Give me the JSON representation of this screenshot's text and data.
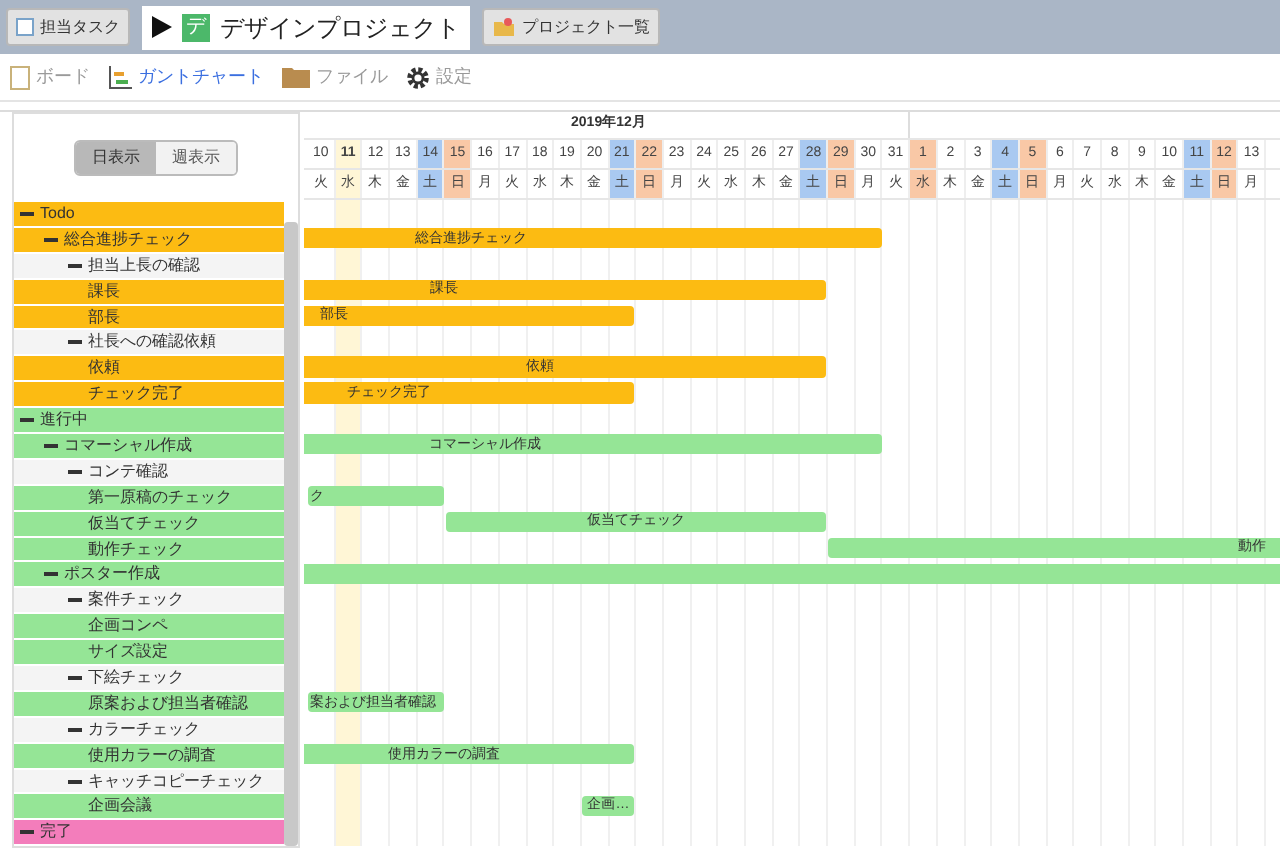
{
  "top_tabs": [
    {
      "label": "担当タスク",
      "kind": "task",
      "selected": false
    },
    {
      "label": "デザインプロジェクト",
      "kind": "project",
      "icon_letter": "デ",
      "selected": true
    },
    {
      "label": "プロジェクト一覧",
      "kind": "list",
      "selected": false
    }
  ],
  "nav": [
    {
      "label": "ボード",
      "kind": "board",
      "selected": false
    },
    {
      "label": "ガントチャート",
      "kind": "gantt",
      "selected": true
    },
    {
      "label": "ファイル",
      "kind": "file",
      "selected": false
    },
    {
      "label": "設定",
      "kind": "settings",
      "selected": false
    }
  ],
  "view_toggle": [
    {
      "label": "日表示",
      "selected": true
    },
    {
      "label": "週表示",
      "selected": false
    }
  ],
  "timeline": {
    "month": "2019年12月",
    "days": [
      {
        "day": "10",
        "weekday": "火",
        "kind": "weekday"
      },
      {
        "day": "11",
        "weekday": "水",
        "kind": "today"
      },
      {
        "day": "12",
        "weekday": "木",
        "kind": "weekday"
      },
      {
        "day": "13",
        "weekday": "金",
        "kind": "weekday"
      },
      {
        "day": "14",
        "weekday": "土",
        "kind": "saturday"
      },
      {
        "day": "15",
        "weekday": "日",
        "kind": "holiday"
      },
      {
        "day": "16",
        "weekday": "月",
        "kind": "weekday"
      },
      {
        "day": "17",
        "weekday": "火",
        "kind": "weekday"
      },
      {
        "day": "18",
        "weekday": "水",
        "kind": "weekday"
      },
      {
        "day": "19",
        "weekday": "木",
        "kind": "weekday"
      },
      {
        "day": "20",
        "weekday": "金",
        "kind": "weekday"
      },
      {
        "day": "21",
        "weekday": "土",
        "kind": "saturday"
      },
      {
        "day": "22",
        "weekday": "日",
        "kind": "holiday"
      },
      {
        "day": "23",
        "weekday": "月",
        "kind": "weekday"
      },
      {
        "day": "24",
        "weekday": "火",
        "kind": "weekday"
      },
      {
        "day": "25",
        "weekday": "水",
        "kind": "weekday"
      },
      {
        "day": "26",
        "weekday": "木",
        "kind": "weekday"
      },
      {
        "day": "27",
        "weekday": "金",
        "kind": "weekday"
      },
      {
        "day": "28",
        "weekday": "土",
        "kind": "saturday"
      },
      {
        "day": "29",
        "weekday": "日",
        "kind": "holiday"
      },
      {
        "day": "30",
        "weekday": "月",
        "kind": "weekday"
      },
      {
        "day": "31",
        "weekday": "火",
        "kind": "weekday"
      },
      {
        "day": "1",
        "weekday": "水",
        "kind": "holiday"
      },
      {
        "day": "2",
        "weekday": "木",
        "kind": "weekday"
      },
      {
        "day": "3",
        "weekday": "金",
        "kind": "weekday"
      },
      {
        "day": "4",
        "weekday": "土",
        "kind": "saturday"
      },
      {
        "day": "5",
        "weekday": "日",
        "kind": "holiday"
      },
      {
        "day": "6",
        "weekday": "月",
        "kind": "weekday"
      },
      {
        "day": "7",
        "weekday": "火",
        "kind": "weekday"
      },
      {
        "day": "8",
        "weekday": "水",
        "kind": "weekday"
      },
      {
        "day": "9",
        "weekday": "木",
        "kind": "weekday"
      },
      {
        "day": "10",
        "weekday": "金",
        "kind": "weekday"
      },
      {
        "day": "11",
        "weekday": "土",
        "kind": "saturday"
      },
      {
        "day": "12",
        "weekday": "日",
        "kind": "holiday"
      },
      {
        "day": "13",
        "weekday": "月",
        "kind": "weekday"
      }
    ]
  },
  "tree": [
    {
      "label": "Todo",
      "color": "#fcbb12",
      "expanded": true,
      "children": [
        {
          "label": "総合進捗チェック",
          "kind": "task",
          "expanded": true,
          "bar": "総合進捗チェック",
          "children": [
            {
              "label": "担当上長の確認",
              "kind": "folder",
              "expanded": true,
              "children": [
                {
                  "label": "課長",
                  "kind": "task",
                  "bar": "課長"
                },
                {
                  "label": "部長",
                  "kind": "task",
                  "bar": "部長"
                }
              ]
            },
            {
              "label": "社長への確認依頼",
              "kind": "folder",
              "expanded": true,
              "children": [
                {
                  "label": "依頼",
                  "kind": "task",
                  "bar": "依頼"
                },
                {
                  "label": "チェック完了",
                  "kind": "task",
                  "bar": "チェック完了"
                }
              ]
            }
          ]
        }
      ]
    },
    {
      "label": "進行中",
      "color": "#95e596",
      "expanded": true,
      "children": [
        {
          "label": "コマーシャル作成",
          "kind": "task",
          "expanded": true,
          "bar": "コマーシャル作成",
          "children": [
            {
              "label": "コンテ確認",
              "kind": "folder",
              "expanded": true,
              "children": [
                {
                  "label": "第一原稿のチェック",
                  "kind": "task",
                  "bar": "ク"
                },
                {
                  "label": "仮当てチェック",
                  "kind": "task",
                  "bar": "仮当てチェック"
                },
                {
                  "label": "動作チェック",
                  "kind": "task",
                  "bar": "動作"
                }
              ]
            }
          ]
        },
        {
          "label": "ポスター作成",
          "kind": "task",
          "expanded": true,
          "bar": true,
          "children": [
            {
              "label": "案件チェック",
              "kind": "folder",
              "expanded": true,
              "children": [
                {
                  "label": "企画コンペ",
                  "kind": "task"
                },
                {
                  "label": "サイズ設定",
                  "kind": "task"
                }
              ]
            },
            {
              "label": "下絵チェック",
              "kind": "folder",
              "expanded": true,
              "children": [
                {
                  "label": "原案および担当者確認",
                  "kind": "task",
                  "bar": "案および担当者確認"
                }
              ]
            },
            {
              "label": "カラーチェック",
              "kind": "folder",
              "expanded": true,
              "children": [
                {
                  "label": "使用カラーの調査",
                  "kind": "task",
                  "bar": "使用カラーの調査"
                }
              ]
            },
            {
              "label": "キャッチコピーチェック",
              "kind": "folder",
              "expanded": true,
              "children": [
                {
                  "label": "企画会議",
                  "kind": "task",
                  "bar": "企画…"
                }
              ]
            }
          ]
        }
      ]
    },
    {
      "label": "完了",
      "color": "#f37dbb",
      "expanded": true
    }
  ]
}
